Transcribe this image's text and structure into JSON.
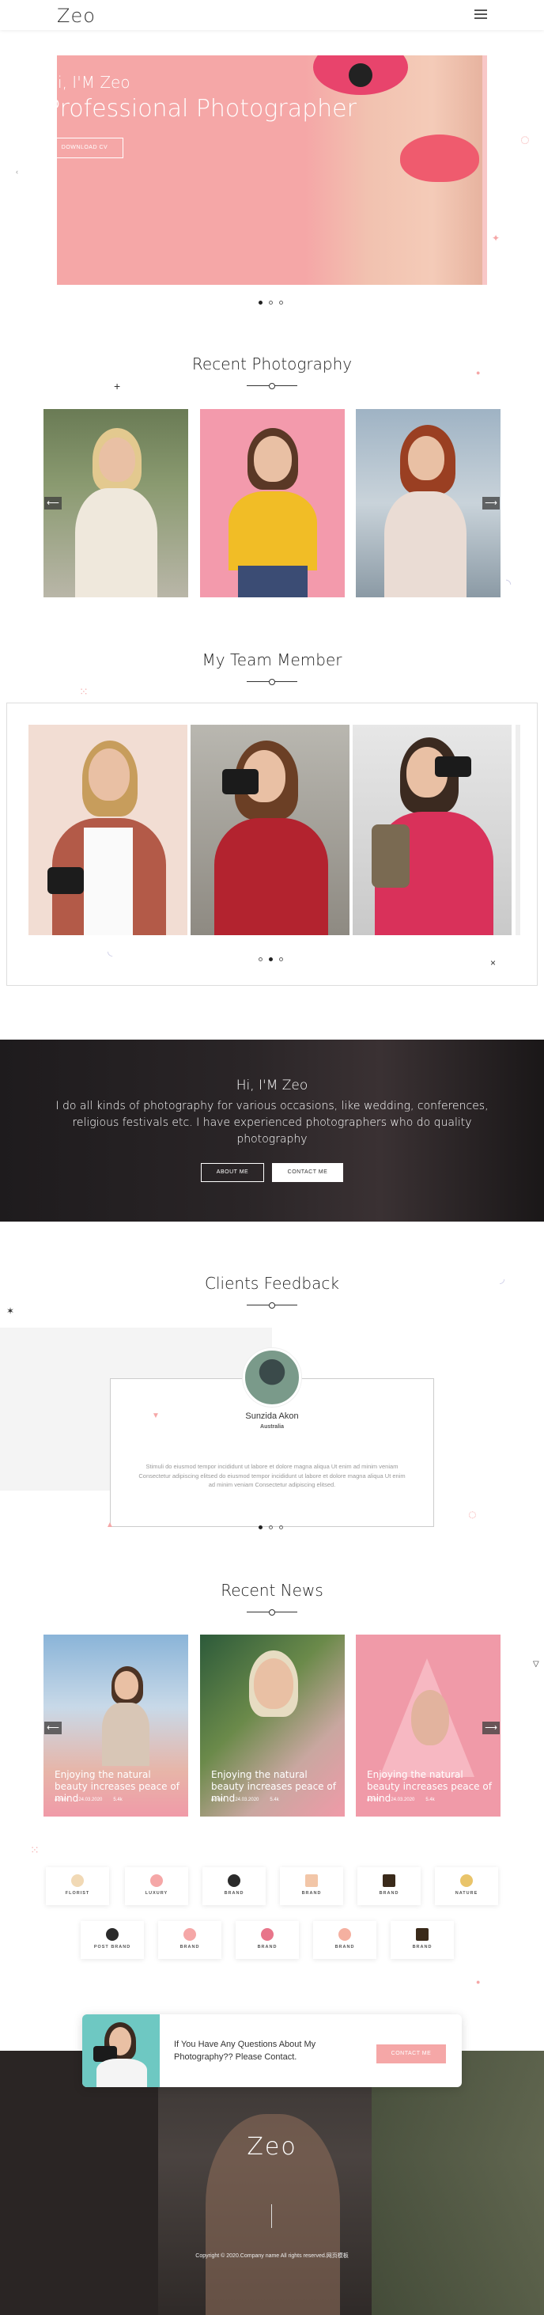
{
  "header": {
    "logo": "Zeo",
    "menu_icon": "hamburger-icon"
  },
  "hero": {
    "greeting": "Hi, I'M Zeo",
    "title": "Professional Photographer",
    "button": "DOWNLOAD CV",
    "slide_count": 3,
    "active_slide": 1
  },
  "recent_photography": {
    "title": "Recent Photography",
    "prev_icon": "arrow-left-icon",
    "next_icon": "arrow-right-icon"
  },
  "team": {
    "title": "My Team Member",
    "slide_count": 3,
    "active_slide": 2
  },
  "banner": {
    "greeting": "Hi, I'M Zeo",
    "text": "I do all kinds of photography for various occasions, like wedding, conferences, religious festivals etc. I have experienced photographers who do quality photography",
    "about_button": "ABOUT ME",
    "contact_button": "CONTACT ME"
  },
  "feedback": {
    "title": "Clients Feedback",
    "name": "Sunzida Akon",
    "country": "Australia",
    "text": "Stimuli do eiusmod tempor incididunt ut labore et dolore magna aliqua Ut enim ad minim veniam Consectetur adipiscing elitsed do eiusmod tempor incididunt ut labore et dolore magna aliqua Ut enim ad minim veniam Consectetur adipiscing elitsed.",
    "slide_count": 3,
    "active_slide": 1
  },
  "news": {
    "title": "Recent News",
    "items": [
      {
        "caption": "Enjoying the natural beauty increases peace of mind",
        "author": "admin",
        "date": "24.03.2020",
        "likes": "5.4k"
      },
      {
        "caption": "Enjoying the natural beauty increases peace of mind",
        "author": "admin",
        "date": "24.03.2020",
        "likes": "5.4k"
      },
      {
        "caption": "Enjoying the natural beauty increases peace of mind",
        "author": "admin",
        "date": "24.03.2020",
        "likes": "5.4k"
      }
    ]
  },
  "brands": {
    "row1": [
      "FLORIST",
      "LUXURY",
      "BRAND",
      "BRAND",
      "BRAND",
      "NATURE"
    ],
    "row2": [
      "POST BRAND",
      "BRAND",
      "BRAND",
      "BRAND",
      "BRAND"
    ]
  },
  "contact": {
    "text": "If You Have Any Questions About My Photography?? Please Contact.",
    "button": "CONTACT ME"
  },
  "footer": {
    "logo": "Zeo",
    "copyright": "Copyright © 2020.Company name All rights reserved.网页模板"
  },
  "colors": {
    "accent": "#f5a7a7",
    "dark": "#222222",
    "light_gray": "#f4f4f4"
  }
}
